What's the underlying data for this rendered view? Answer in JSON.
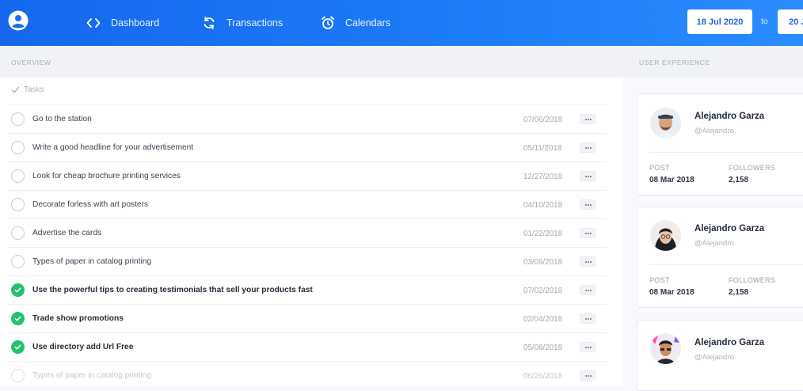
{
  "colors": {
    "header_gradient": [
      "#1568ee",
      "#2a8cff"
    ],
    "accent": "#1f64d8",
    "done_green": "#22c26e"
  },
  "header": {
    "icon": "user-circle-icon",
    "nav": [
      {
        "label": "Dashboard",
        "icon": "code-brackets-icon"
      },
      {
        "label": "Transactions",
        "icon": "refresh-icon"
      },
      {
        "label": "Calendars",
        "icon": "alarm-clock-icon"
      }
    ],
    "date_from": "18 Jul 2020",
    "to_label": "to",
    "date_to": "20 J"
  },
  "overview": {
    "title": "OVERVIEW",
    "tasks_label": "Tasks",
    "tasks": [
      {
        "label": "Go to the station",
        "date": "07/06/2018",
        "done": false
      },
      {
        "label": "Write a good headline for your advertisement",
        "date": "05/11/2018",
        "done": false
      },
      {
        "label": "Look for cheap brochure printing services",
        "date": "12/27/2018",
        "done": false
      },
      {
        "label": "Decorate forless with art posters",
        "date": "04/10/2018",
        "done": false
      },
      {
        "label": "Advertise the cards",
        "date": "01/22/2018",
        "done": false
      },
      {
        "label": "Types of paper in catalog printing",
        "date": "03/09/2018",
        "done": false
      },
      {
        "label": "Use the powerful tips to creating testimonials that sell your products fast",
        "date": "07/02/2018",
        "done": true
      },
      {
        "label": "Trade show promotions",
        "date": "02/04/2018",
        "done": true
      },
      {
        "label": "Use directory add Url Free",
        "date": "05/08/2018",
        "done": true
      },
      {
        "label": "Types of paper in catalog printing",
        "date": "06/26/2018",
        "done": false
      }
    ]
  },
  "user_experience": {
    "title": "USER EXPERIENCE",
    "cards": [
      {
        "name": "Alejandro Garza",
        "handle": "@Alejandro",
        "post_label": "POST",
        "post": "08 Mar 2018",
        "followers_label": "FOLLOWERS",
        "followers": "2,158"
      },
      {
        "name": "Alejandro Garza",
        "handle": "@Alejandro",
        "post_label": "POST",
        "post": "08 Mar 2018",
        "followers_label": "FOLLOWERS",
        "followers": "2,158"
      },
      {
        "name": "Alejandro Garza",
        "handle": "@Alejandro"
      }
    ]
  }
}
